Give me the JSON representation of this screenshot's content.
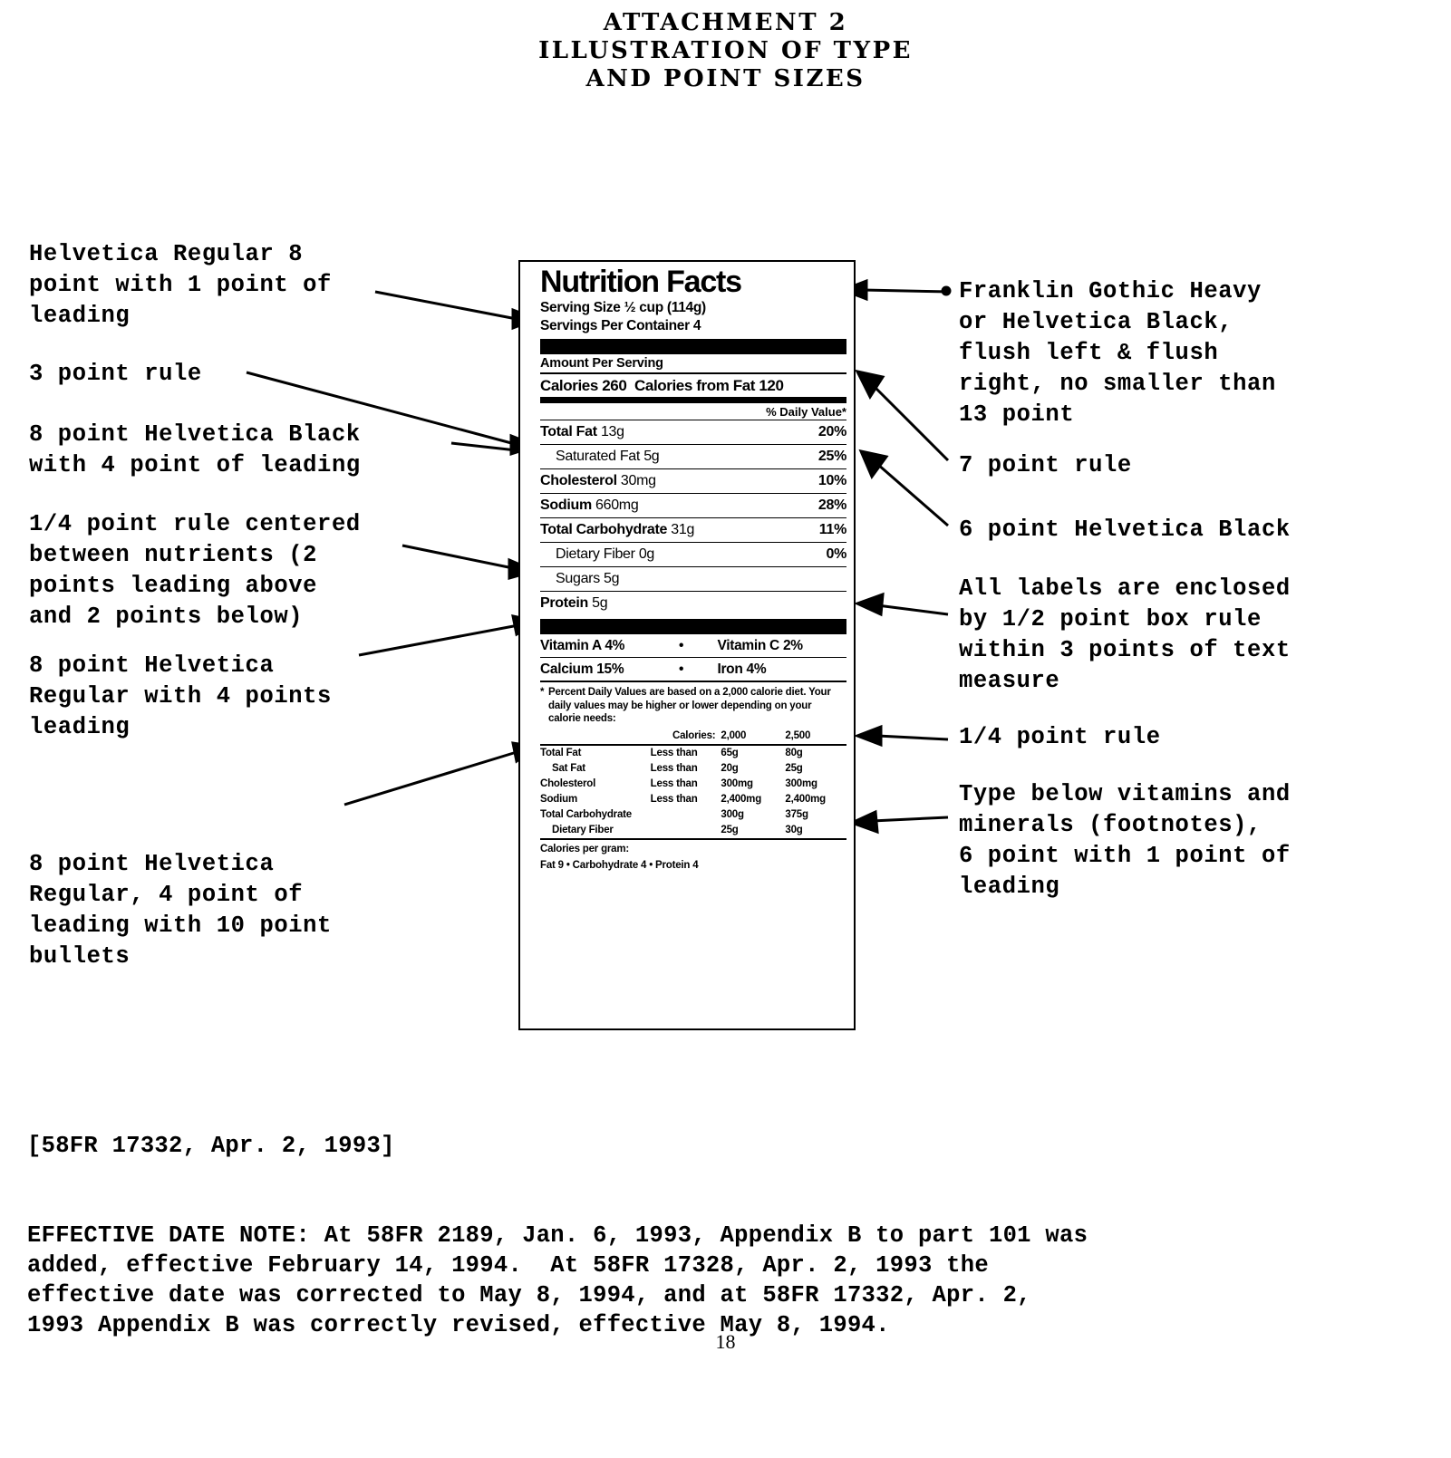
{
  "document": {
    "title_lines": [
      "ATTACHMENT 2",
      "ILLUSTRATION OF TYPE",
      "AND POINT SIZES"
    ],
    "page_number": "18"
  },
  "annotations": {
    "left": [
      {
        "id": "helvetica-regular-8-point",
        "text": "Helvetica Regular 8\npoint with 1 point of\nleading"
      },
      {
        "id": "three-point-rule",
        "text": "3 point rule"
      },
      {
        "id": "eight-point-helvetica-black",
        "text": "8 point Helvetica Black\nwith 4 point of leading"
      },
      {
        "id": "quarter-point-rule-centered",
        "text": "1/4 point rule centered\nbetween nutrients (2\npoints leading above\nand 2 points below)"
      },
      {
        "id": "eight-point-helvetica-regular",
        "text": "8 point Helvetica\nRegular with 4 points\nleading"
      },
      {
        "id": "eight-point-helvetica-regular-bullets",
        "text": "8 point Helvetica\nRegular, 4 point of\nleading with 10 point\nbullets"
      }
    ],
    "right": [
      {
        "id": "franklin-gothic-heavy",
        "text": "Franklin Gothic Heavy\nor Helvetica Black,\nflush left & flush\nright, no smaller than\n13 point"
      },
      {
        "id": "seven-point-rule",
        "text": "7 point rule"
      },
      {
        "id": "six-point-helvetica-black",
        "text": "6 point Helvetica Black"
      },
      {
        "id": "box-rule",
        "text": "All labels are enclosed\nby 1/2 point box rule\nwithin 3 points of text\nmeasure"
      },
      {
        "id": "quarter-point-rule",
        "text": "1/4 point rule"
      },
      {
        "id": "type-below-vitamins",
        "text": "Type below vitamins and\nminerals (footnotes),\n6 point with 1 point of\nleading"
      }
    ]
  },
  "nutrition_label": {
    "title": "Nutrition Facts",
    "serving_size": "Serving Size ½ cup (114g)",
    "servings_per_container": "Servings Per Container 4",
    "amount_per_serving": "Amount Per Serving",
    "calories": "Calories 260",
    "calories_from_fat": "Calories from Fat 120",
    "daily_value_header": "% Daily Value*",
    "nutrients": [
      {
        "name": "Total Fat",
        "amount": "13g",
        "dv": "20%",
        "indent": false
      },
      {
        "name": "Saturated Fat",
        "amount": "5g",
        "dv": "25%",
        "indent": true
      },
      {
        "name": "Cholesterol",
        "amount": "30mg",
        "dv": "10%",
        "indent": false
      },
      {
        "name": "Sodium",
        "amount": "660mg",
        "dv": "28%",
        "indent": false
      },
      {
        "name": "Total Carbohydrate",
        "amount": "31g",
        "dv": "11%",
        "indent": false
      },
      {
        "name": "Dietary Fiber",
        "amount": "0g",
        "dv": "0%",
        "indent": true
      },
      {
        "name": "Sugars",
        "amount": "5g",
        "dv": "",
        "indent": true
      },
      {
        "name": "Protein",
        "amount": "5g",
        "dv": "",
        "indent": false
      }
    ],
    "vitamins": [
      {
        "left": "Vitamin A 4%",
        "dot": "•",
        "right": "Vitamin C 2%"
      },
      {
        "left": "Calcium 15%",
        "dot": "•",
        "right": "Iron 4%"
      }
    ],
    "footnote_star": "*",
    "footnote": "Percent Daily Values are based on a 2,000 calorie diet. Your daily values may be higher or lower depending on your calorie needs:",
    "dv_table": {
      "head": {
        "label": "Calories:",
        "col_a": "2,000",
        "col_b": "2,500"
      },
      "rows": [
        {
          "label": "Total Fat",
          "less": "Less than",
          "a": "65g",
          "b": "80g",
          "indent": false
        },
        {
          "label": "Sat Fat",
          "less": "Less than",
          "a": "20g",
          "b": "25g",
          "indent": true
        },
        {
          "label": "Cholesterol",
          "less": "Less than",
          "a": "300mg",
          "b": "300mg",
          "indent": false
        },
        {
          "label": "Sodium",
          "less": "Less than",
          "a": "2,400mg",
          "b": "2,400mg",
          "indent": false
        },
        {
          "label": "Total Carbohydrate",
          "less": "",
          "a": "300g",
          "b": "375g",
          "indent": false
        },
        {
          "label": "Dietary Fiber",
          "less": "",
          "a": "25g",
          "b": "30g",
          "indent": true
        }
      ]
    },
    "calories_per_gram_label": "Calories per gram:",
    "calories_per_gram_values": "Fat 9  •  Carbohydrate 4  •  Protein 4"
  },
  "legal": {
    "citation": "[58FR 17332, Apr. 2, 1993]",
    "effective_date_note": "EFFECTIVE DATE NOTE: At 58FR 2189, Jan. 6, 1993, Appendix B to part 101 was\nadded, effective February 14, 1994.  At 58FR 17328, Apr. 2, 1993 the\neffective date was corrected to May 8, 1994, and at 58FR 17332, Apr. 2,\n1993 Appendix B was correctly revised, effective May 8, 1994."
  }
}
